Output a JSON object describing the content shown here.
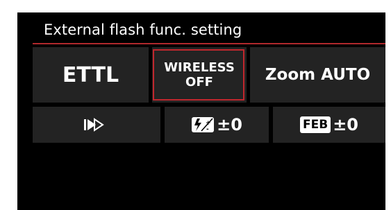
{
  "screen": {
    "title": "External flash func. setting"
  },
  "grid": {
    "flash_mode": "ETTL",
    "wireless_line1": "WIRELESS",
    "wireless_line2": "OFF",
    "zoom": "Zoom AUTO",
    "firing_mode_icon": "high-speed-sync-icon",
    "fec_icon": "flash-exposure-comp-icon",
    "fec_value": "±0",
    "feb_label": "FEB",
    "feb_value": "±0"
  },
  "colors": {
    "background": "#000000",
    "cell": "#232323",
    "accent": "#c1272d",
    "text": "#ffffff"
  }
}
